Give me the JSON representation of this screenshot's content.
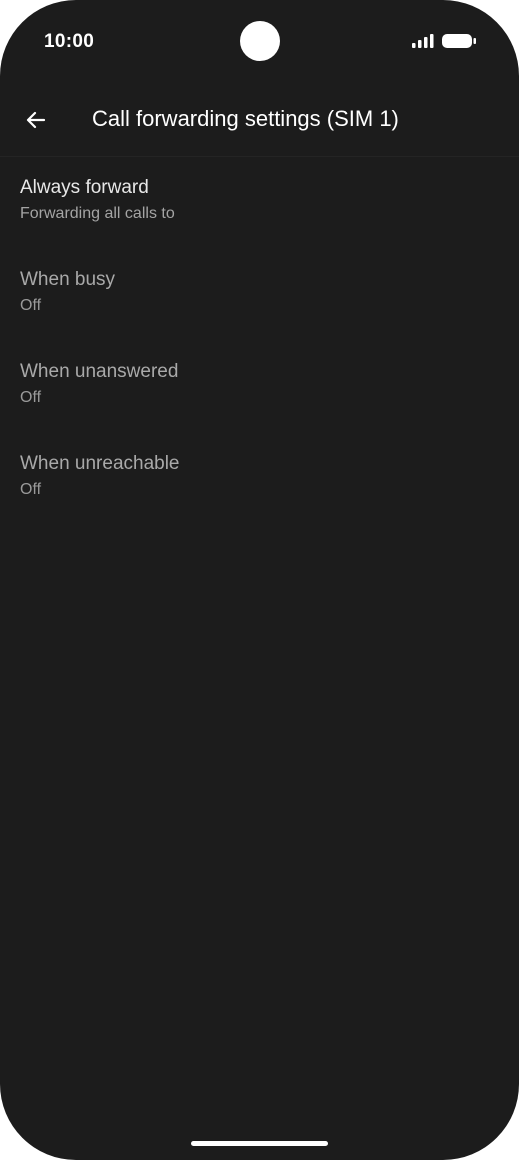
{
  "status_bar": {
    "time": "10:00",
    "signal_icon": "signal-bars-icon",
    "battery_icon": "battery-full-icon"
  },
  "app_bar": {
    "back_icon": "arrow-back-icon",
    "title": "Call forwarding settings (SIM 1)"
  },
  "items": [
    {
      "title": "Always forward",
      "summary": "Forwarding all calls to",
      "enabled": true
    },
    {
      "title": "When busy",
      "summary": "Off",
      "enabled": false
    },
    {
      "title": "When unanswered",
      "summary": "Off",
      "enabled": false
    },
    {
      "title": "When unreachable",
      "summary": "Off",
      "enabled": false
    }
  ],
  "colors": {
    "background": "#1c1c1c",
    "primary_text": "#e8e8e8",
    "secondary_text": "#a4a4a4"
  }
}
